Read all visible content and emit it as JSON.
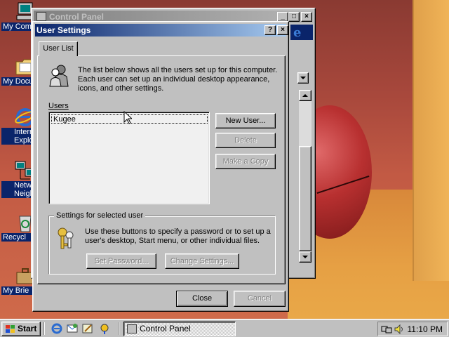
{
  "desktop": {
    "icons": [
      {
        "label": "My Com",
        "icon": "computer-icon"
      },
      {
        "label": "My Docu",
        "icon": "folder-icon"
      },
      {
        "label": "Interr",
        "label2": "Explo",
        "icon": "ie-icon"
      },
      {
        "label": "Netw",
        "label2": "Neighbo",
        "icon": "network-icon"
      },
      {
        "label": "Recycl",
        "icon": "recycle-bin-icon"
      },
      {
        "label": "My Brie",
        "icon": "briefcase-icon"
      }
    ]
  },
  "control_panel": {
    "title": "Control Panel",
    "colors": {
      "inactive_title_start": "#808080",
      "inactive_title_end": "#b5b5b5"
    }
  },
  "dialog": {
    "title": "User Settings",
    "help_glyph": "?",
    "close_glyph": "×",
    "tab_label": "User List",
    "intro_text": "The list below shows all the users set up for this computer. Each user can set up an individual desktop appearance, icons, and other settings.",
    "users_label": "Users",
    "users": [
      "Kugee"
    ],
    "buttons": {
      "new_user": "New User...",
      "delete": "Delete",
      "make_copy": "Make a Copy",
      "set_password": "Set Password...",
      "change_settings": "Change Settings...",
      "close": "Close",
      "cancel": "Cancel"
    },
    "group_label": "Settings for selected user",
    "group_text": "Use these buttons to specify a password or to set up a user's desktop, Start menu, or other individual files.",
    "colors": {
      "active_title_start": "#0a246a",
      "active_title_end": "#a6caf0",
      "face": "#c0c0c0"
    }
  },
  "taskbar": {
    "start_label": "Start",
    "quick_launch": [
      "ie-icon",
      "outlook-express-icon",
      "show-desktop-icon",
      "channels-icon"
    ],
    "task_label": "Control Panel",
    "clock": "11:10 PM",
    "tray_icons": [
      "network-tray-icon",
      "volume-icon"
    ]
  }
}
